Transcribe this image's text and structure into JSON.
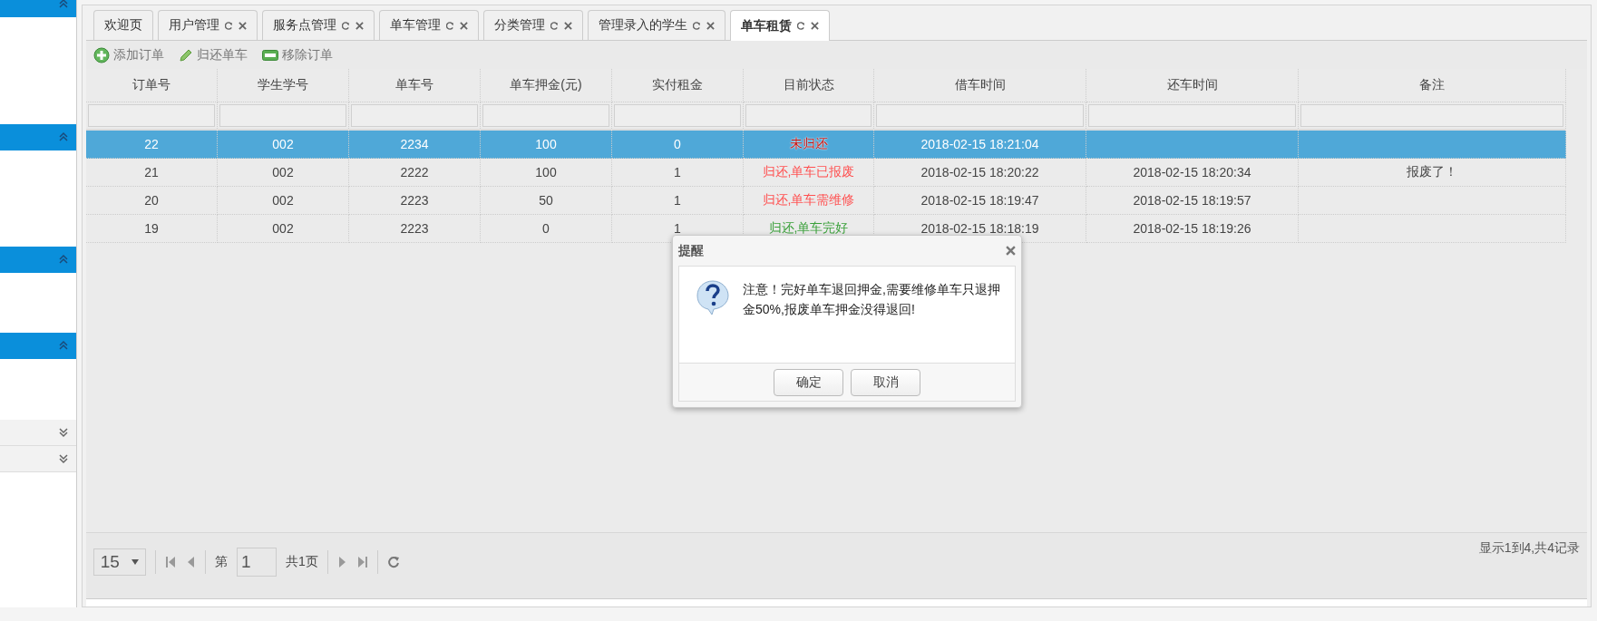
{
  "sidebar": {
    "panels": [
      {
        "expanded": true
      },
      {
        "expanded": true
      },
      {
        "expanded": true
      },
      {
        "expanded": true
      },
      {
        "expanded": false
      },
      {
        "expanded": false
      }
    ]
  },
  "tabs": [
    {
      "label": "欢迎页",
      "selected": false,
      "closable": false
    },
    {
      "label": "用户管理",
      "selected": false,
      "closable": true
    },
    {
      "label": "服务点管理",
      "selected": false,
      "closable": true
    },
    {
      "label": "单车管理",
      "selected": false,
      "closable": true
    },
    {
      "label": "分类管理",
      "selected": false,
      "closable": true
    },
    {
      "label": "管理录入的学生",
      "selected": false,
      "closable": true
    },
    {
      "label": "单车租赁",
      "selected": true,
      "closable": true
    }
  ],
  "toolbar": [
    {
      "kind": "add",
      "label": "添加订单"
    },
    {
      "kind": "edit",
      "label": "归还单车"
    },
    {
      "kind": "remove",
      "label": "移除订单"
    }
  ],
  "table": {
    "columns": [
      "订单号",
      "学生学号",
      "单车号",
      "单车押金(元)",
      "实付租金",
      "目前状态",
      "借车时间",
      "还车时间",
      "备注"
    ],
    "rows": [
      {
        "selected": true,
        "order": "22",
        "student": "002",
        "bike": "2234",
        "deposit": "100",
        "rent": "0",
        "status": {
          "text": "未归还",
          "color": "#c01010"
        },
        "borrowed": "2018-02-15 18:21:04"
      },
      {
        "selected": false,
        "order": "21",
        "student": "002",
        "bike": "2222",
        "deposit": "100",
        "rent": "1",
        "status": {
          "text": "归还,单车已报废",
          "color": "#ff5050"
        },
        "borrowed": "2018-02-15 18:20:22",
        "returned": "2018-02-15 18:20:34",
        "note": "报废了！"
      },
      {
        "selected": false,
        "order": "20",
        "student": "002",
        "bike": "2223",
        "deposit": "50",
        "rent": "1",
        "status": {
          "text": "归还,单车需维修",
          "color": "#ff5050"
        },
        "borrowed": "2018-02-15 18:19:47",
        "returned": "2018-02-15 18:19:57"
      },
      {
        "selected": false,
        "order": "19",
        "student": "002",
        "bike": "2223",
        "deposit": "0",
        "rent": "1",
        "status": {
          "text": "归还,单车完好",
          "color": "#3aa03a"
        },
        "borrowed": "2018-02-15 18:18:19",
        "returned": "2018-02-15 18:19:26"
      }
    ]
  },
  "pagination": {
    "page_size": "15",
    "page_prefix": "第",
    "page": "1",
    "page_total": "共1页",
    "summary": "显示1到4,共4记录"
  },
  "dialog": {
    "title": "提醒",
    "message": "注意！完好单车退回押金,需要维修单车只退押金50%,报废单车押金没得退回!",
    "buttons": [
      "确定",
      "取消"
    ]
  }
}
